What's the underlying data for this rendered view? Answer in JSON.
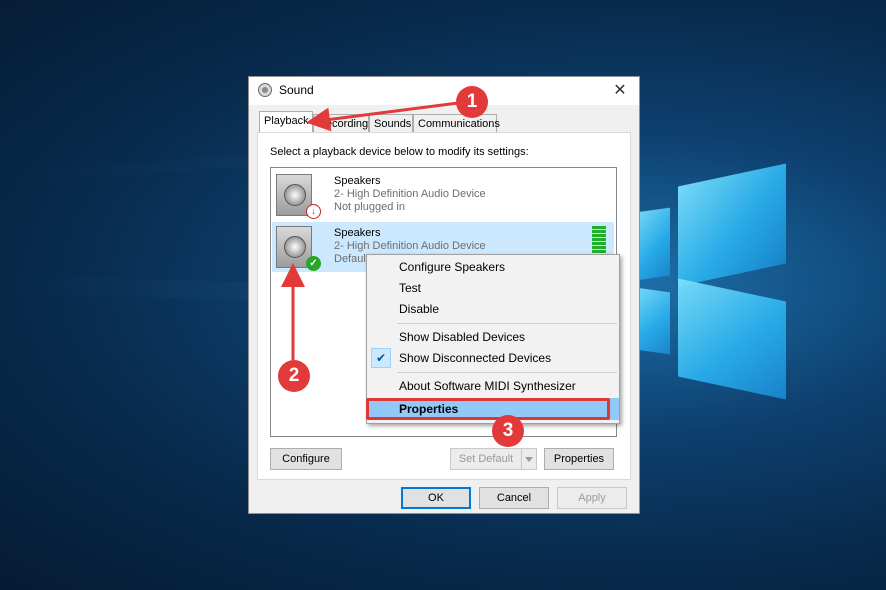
{
  "window": {
    "title": "Sound",
    "close_glyph": "✕"
  },
  "tabs": [
    {
      "label": "Playback",
      "active": true
    },
    {
      "label": "Recording",
      "active": false
    },
    {
      "label": "Sounds",
      "active": false
    },
    {
      "label": "Communications",
      "active": false
    }
  ],
  "instruction": "Select a playback device below to modify its settings:",
  "devices": [
    {
      "name": "Speakers",
      "subtitle": "2- High Definition Audio Device",
      "status": "Not plugged in",
      "badge": "red-down-arrow",
      "icon": "speaker-icon",
      "selected": false
    },
    {
      "name": "Speakers",
      "subtitle": "2- High Definition Audio Device",
      "status": "Default",
      "badge": "green-check",
      "icon": "speaker-icon",
      "selected": true
    }
  ],
  "buttons": {
    "configure": "Configure",
    "set_default": "Set Default",
    "properties": "Properties",
    "ok": "OK",
    "cancel": "Cancel",
    "apply": "Apply"
  },
  "context_menu": {
    "items": [
      {
        "label": "Configure Speakers"
      },
      {
        "label": "Test"
      },
      {
        "label": "Disable"
      },
      {
        "label": "Show Disabled Devices"
      },
      {
        "label": "Show Disconnected Devices",
        "checked": true
      },
      {
        "label": "About Software MIDI Synthesizer"
      },
      {
        "label": "Properties",
        "highlighted": true
      }
    ],
    "check_glyph": "✔"
  },
  "annotations": {
    "step1": "1",
    "step2": "2",
    "step3": "3",
    "color": "#e2393b"
  },
  "colors": {
    "accent": "#0078d7",
    "selection": "#cce8ff",
    "level_meter": "#21b02b"
  }
}
